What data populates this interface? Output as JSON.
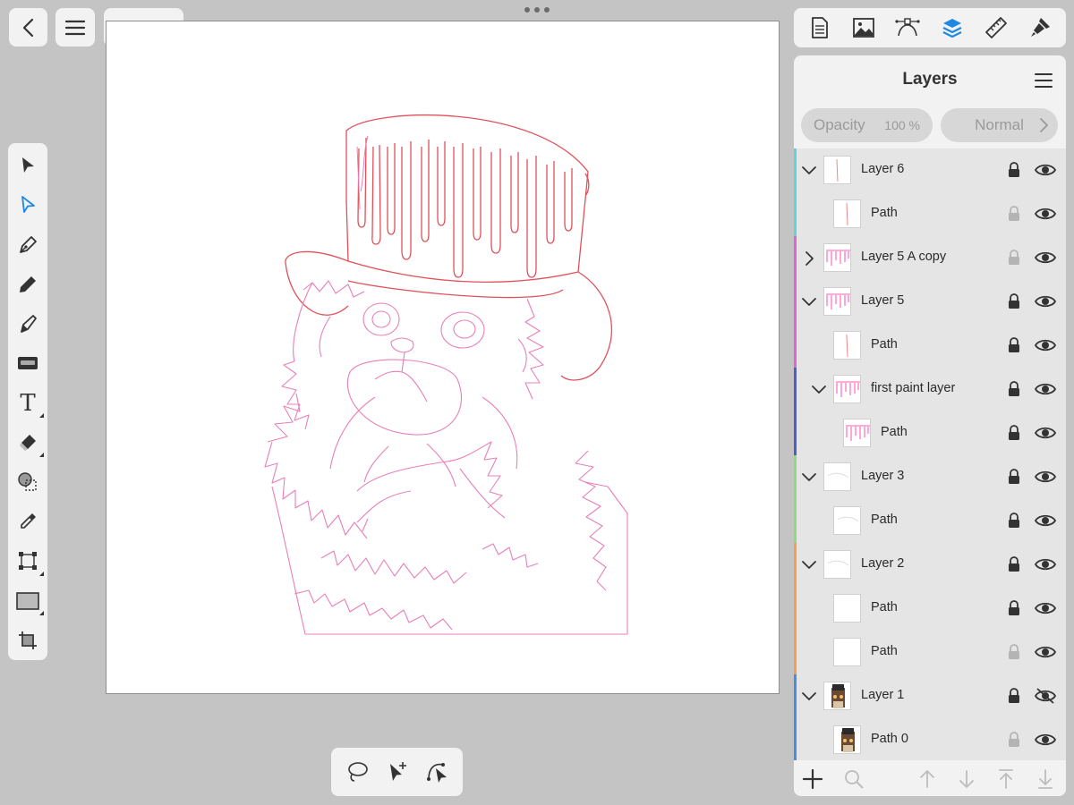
{
  "app": {
    "history": {
      "undo_icon": "undo-icon",
      "redo_icon": "redo-icon",
      "redo_enabled": false
    },
    "top_left": {
      "back_icon": "chevron-left-icon",
      "menu_icon": "hamburger-menu-icon"
    }
  },
  "tools": [
    {
      "id": "move-tool",
      "icon": "move-arrow-icon",
      "active": false,
      "has_options": false
    },
    {
      "id": "node-tool",
      "icon": "node-arrow-icon",
      "active": true,
      "has_options": false
    },
    {
      "id": "pen-tool",
      "icon": "pen-nib-icon",
      "active": false,
      "has_options": false
    },
    {
      "id": "pencil-tool",
      "icon": "pencil-icon",
      "active": false,
      "has_options": false
    },
    {
      "id": "vector-brush-tool",
      "icon": "vector-brush-icon",
      "active": false,
      "has_options": false
    },
    {
      "id": "fill-tool",
      "icon": "fill-tool-icon",
      "active": false,
      "has_options": false
    },
    {
      "id": "text-tool",
      "icon": "text-icon",
      "label": "T",
      "active": false,
      "has_options": true
    },
    {
      "id": "eraser-tool",
      "icon": "eraser-icon",
      "active": false,
      "has_options": true
    },
    {
      "id": "shape-builder-tool",
      "icon": "shape-builder-icon",
      "active": false,
      "has_options": false
    },
    {
      "id": "color-picker-tool",
      "icon": "eyedropper-icon",
      "active": false,
      "has_options": false
    },
    {
      "id": "transform-tool",
      "icon": "transform-icon",
      "active": false,
      "has_options": true
    },
    {
      "id": "rectangle-tool",
      "icon": "rectangle-icon",
      "active": false,
      "has_options": true
    },
    {
      "id": "crop-tool",
      "icon": "crop-icon",
      "active": false,
      "has_options": false
    }
  ],
  "context_toolbar": [
    {
      "id": "lasso-select",
      "icon": "lasso-icon"
    },
    {
      "id": "add-node-select",
      "icon": "arrow-plus-icon"
    },
    {
      "id": "curve-select",
      "icon": "curve-arrow-icon"
    }
  ],
  "studio_tabs": [
    {
      "id": "document-tab",
      "icon": "document-icon",
      "active": false
    },
    {
      "id": "image-tab",
      "icon": "image-icon",
      "active": false
    },
    {
      "id": "curve-tab",
      "icon": "bezier-curve-icon",
      "active": false
    },
    {
      "id": "layers-tab",
      "icon": "layers-icon",
      "active": true
    },
    {
      "id": "ruler-tab",
      "icon": "ruler-icon",
      "active": false
    },
    {
      "id": "brush-tab",
      "icon": "paint-brush-icon",
      "active": false
    }
  ],
  "layers_panel": {
    "title": "Layers",
    "opacity_label": "Opacity",
    "opacity_value": "100 %",
    "blend_mode": "Normal",
    "layers": [
      {
        "name": "Layer 6",
        "depth": 0,
        "expanded": true,
        "has_children": true,
        "color": "#5bd6d6",
        "locked": true,
        "visible": true
      },
      {
        "name": "Path",
        "depth": 1,
        "has_children": false,
        "color": "#5bd6d6",
        "locked": false,
        "visible": true
      },
      {
        "name": "Layer 5 A copy",
        "depth": 0,
        "expanded": false,
        "has_children": true,
        "color": "#e065d6",
        "locked": false,
        "visible": true
      },
      {
        "name": "Layer 5",
        "depth": 0,
        "expanded": true,
        "has_children": true,
        "color": "#e065d6",
        "locked": true,
        "visible": true
      },
      {
        "name": "Path",
        "depth": 1,
        "has_children": false,
        "color": "#e065d6",
        "locked": true,
        "visible": true
      },
      {
        "name": "first paint layer",
        "depth": 1,
        "expanded": true,
        "has_children": true,
        "color": "#4f5fc8",
        "locked": true,
        "visible": true
      },
      {
        "name": "Path",
        "depth": 2,
        "has_children": false,
        "color": "#4f5fc8",
        "locked": true,
        "visible": true
      },
      {
        "name": "Layer 3",
        "depth": 0,
        "expanded": true,
        "has_children": true,
        "color": "#8fdc7a",
        "locked": true,
        "visible": true
      },
      {
        "name": "Path",
        "depth": 1,
        "has_children": false,
        "color": "#8fdc7a",
        "locked": true,
        "visible": true
      },
      {
        "name": "Layer 2",
        "depth": 0,
        "expanded": true,
        "has_children": true,
        "color": "#f0a050",
        "locked": true,
        "visible": true
      },
      {
        "name": "Path",
        "depth": 1,
        "has_children": false,
        "color": "#f0a050",
        "locked": true,
        "visible": true
      },
      {
        "name": "Path",
        "depth": 1,
        "has_children": false,
        "color": "#f0a050",
        "locked": false,
        "visible": true
      },
      {
        "name": "Layer 1",
        "depth": 0,
        "expanded": true,
        "has_children": true,
        "color": "#4a8ee0",
        "locked": true,
        "visible": false
      },
      {
        "name": "Path 0",
        "depth": 1,
        "has_children": false,
        "color": "#4a8ee0",
        "locked": false,
        "visible": true
      }
    ],
    "footer": [
      {
        "id": "add-layer",
        "icon": "plus-icon",
        "enabled": true
      },
      {
        "id": "search-layers",
        "icon": "search-icon",
        "enabled": false
      },
      {
        "id": "move-layer-up",
        "icon": "arrow-up-icon",
        "enabled": false
      },
      {
        "id": "move-layer-down",
        "icon": "arrow-down-icon",
        "enabled": false
      },
      {
        "id": "move-layer-top",
        "icon": "arrow-to-top-icon",
        "enabled": false
      },
      {
        "id": "move-layer-bottom",
        "icon": "arrow-to-bottom-icon",
        "enabled": false
      }
    ]
  },
  "colors": {
    "accent": "#1e88e5",
    "panel_bg": "#f2f2f2",
    "list_bg": "#e5e5e5",
    "app_bg": "#c4c4c4",
    "stroke_red": "#e0505a",
    "stroke_pink": "#e880b8"
  }
}
